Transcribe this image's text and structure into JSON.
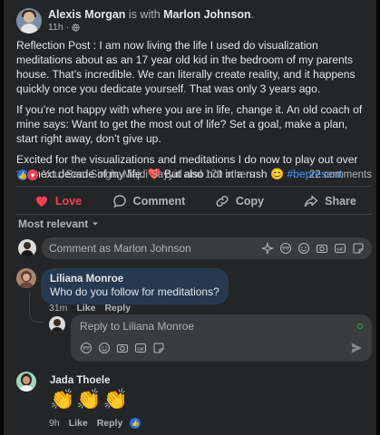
{
  "post": {
    "author": "Alexis Morgan",
    "with_text": "is with",
    "tagged": "Marlon Johnson",
    "time": "11h",
    "dot": "·",
    "paragraphs": [
      "Reflection Post : I am now living the life I used do visualization meditations about as an 17 year old kid in the bedroom of my parents house. That’s incredible. We can literally create reality, and it happens quickly once you dedicate yourself. That was only 3 years ago.",
      "If you’re not happy with where you are in life, change it. An old coach of mine says: Want to get the most out of life? Set a goal, make a plan, start right away, don’t give up."
    ],
    "last_paragraph": {
      "text_before": "Excited for the visualizations and meditations I do now to play out over the next decade of my life.",
      "heart": "❤️",
      "text_middle": "But also not in a rush",
      "emoji": "😊",
      "hashtag": "#bepresent"
    },
    "reactions_text": "You, Sam Singh, Majdi Sayyid and 170 others",
    "comments_count": "22 comments"
  },
  "actions": {
    "love": "Love",
    "comment": "Comment",
    "copy": "Copy",
    "share": "Share"
  },
  "sort_label": "Most relevant",
  "compose": {
    "placeholder": "Comment as Marlon Johnson"
  },
  "comments": [
    {
      "name": "Liliana Monroe",
      "text": "Who do you follow for meditations?",
      "time": "31m",
      "like": "Like",
      "reply": "Reply"
    },
    {
      "name": "Jada Thoele",
      "emojis": [
        "👏",
        "👏",
        "👏"
      ],
      "time": "9h",
      "like": "Like",
      "reply": "Reply"
    }
  ],
  "reply_box": {
    "placeholder": "Reply to Liliana Monroe"
  },
  "colors": {
    "background": "#242526",
    "accent": "#1b74e4",
    "love": "#f33e58",
    "highlight_bubble": "#263951"
  }
}
